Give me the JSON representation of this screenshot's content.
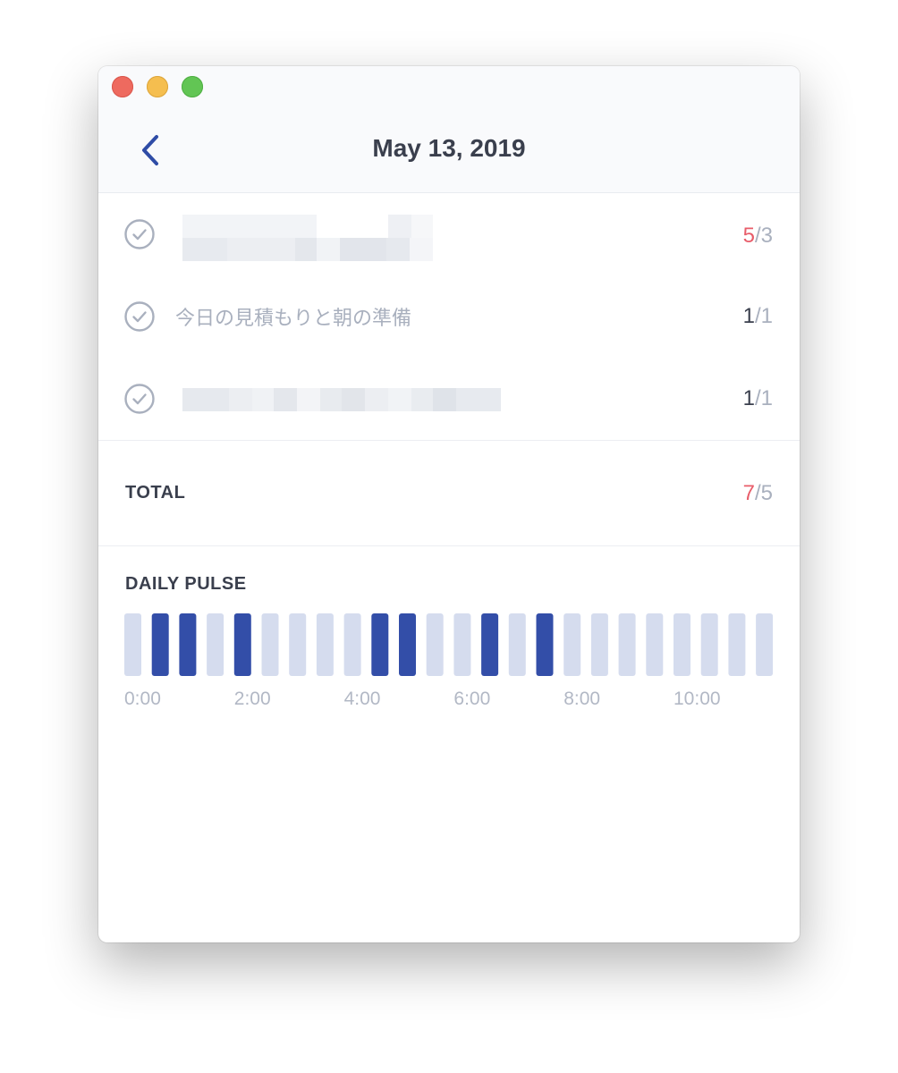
{
  "header": {
    "title": "May 13, 2019",
    "back_icon": "chevron-left-icon"
  },
  "tasks": [
    {
      "label": "",
      "redacted": true,
      "done": "5",
      "goal": "3",
      "over": true
    },
    {
      "label": "今日の見積もりと朝の準備",
      "redacted": false,
      "done": "1",
      "goal": "1",
      "over": false
    },
    {
      "label": "",
      "redacted": true,
      "done": "1",
      "goal": "1",
      "over": false
    }
  ],
  "total": {
    "label": "TOTAL",
    "done": "7",
    "goal": "5",
    "over": true
  },
  "pulse": {
    "title": "DAILY PULSE",
    "active": [
      0,
      1,
      1,
      0,
      1,
      0,
      0,
      0,
      0,
      1,
      1,
      0,
      0,
      1,
      0,
      1,
      0,
      0,
      0,
      0,
      0,
      0,
      0,
      0
    ],
    "tick_labels": [
      "0:00",
      "2:00",
      "4:00",
      "6:00",
      "8:00",
      "10:00"
    ],
    "tick_slots": [
      0,
      4,
      8,
      12,
      16,
      20
    ]
  },
  "colors": {
    "active": "#334ea8",
    "inactive": "#d5dcee",
    "over": "#e85d6a",
    "muted": "#a9b0be",
    "text": "#3a3f4d",
    "accent": "#2f4ca6"
  }
}
